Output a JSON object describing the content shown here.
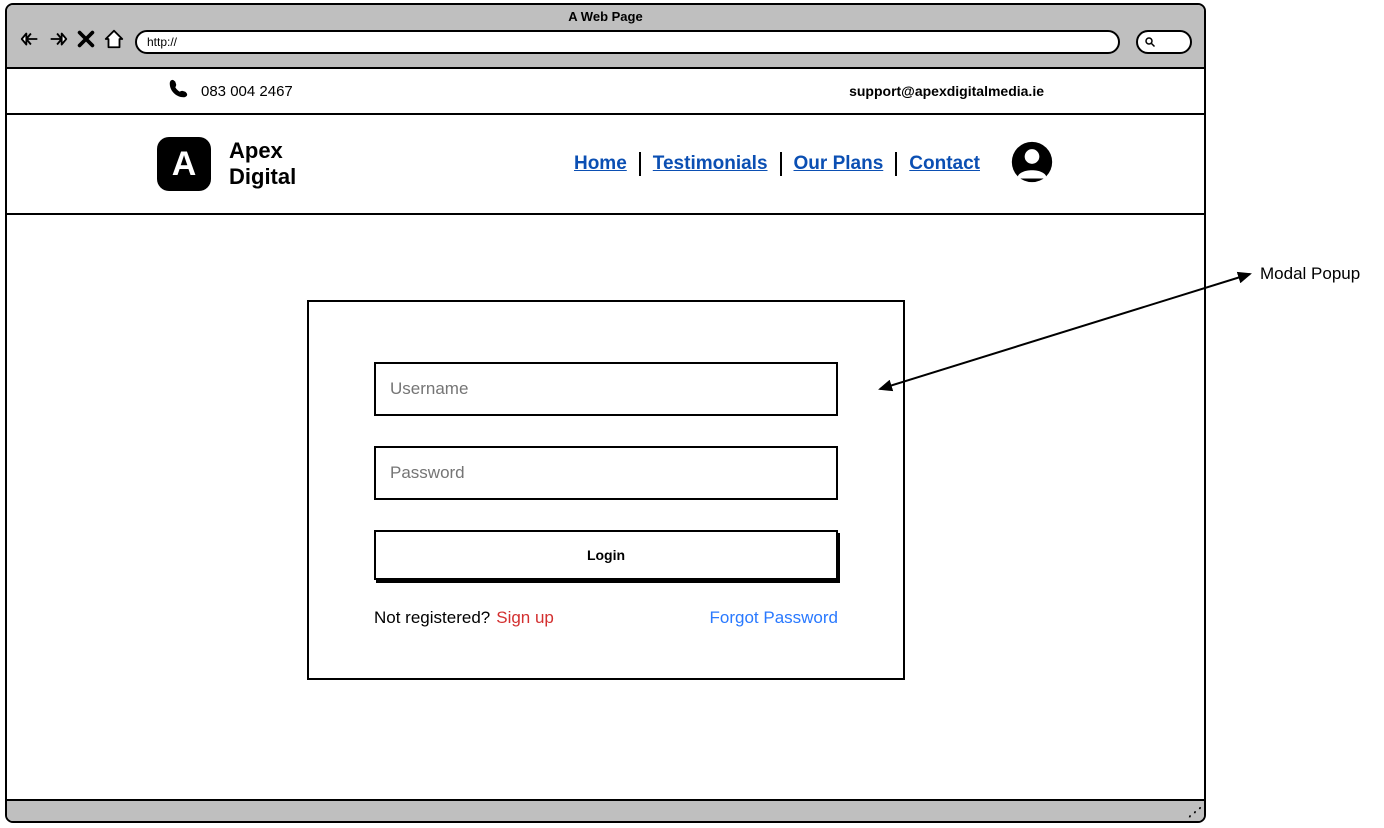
{
  "browser": {
    "title": "A Web Page",
    "url": "http://"
  },
  "topbar": {
    "phone": "083 004 2467",
    "email": "support@apexdigitalmedia.ie"
  },
  "brand": {
    "logo_letter": "A",
    "name_line1": "Apex",
    "name_line2": "Digital"
  },
  "nav": {
    "items": [
      "Home",
      "Testimonials",
      "Our Plans",
      "Contact"
    ]
  },
  "modal": {
    "username_placeholder": "Username",
    "password_placeholder": "Password",
    "login_button": "Login",
    "not_registered": "Not registered?",
    "signup": "Sign up",
    "forgot": "Forgot Password"
  },
  "annotation": {
    "label": "Modal Popup"
  }
}
